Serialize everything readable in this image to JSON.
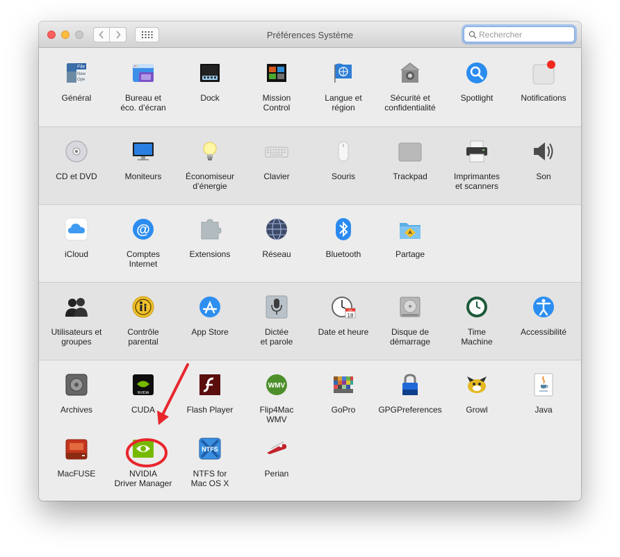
{
  "window": {
    "title": "Préférences Système"
  },
  "search": {
    "placeholder": "Rechercher"
  },
  "sections": [
    {
      "items": [
        {
          "label": "Général",
          "icon": "general-icon"
        },
        {
          "label": "Bureau et\néco. d’écran",
          "icon": "desktop-screensaver-icon"
        },
        {
          "label": "Dock",
          "icon": "dock-icon"
        },
        {
          "label": "Mission\nControl",
          "icon": "mission-control-icon"
        },
        {
          "label": "Langue et\nrégion",
          "icon": "language-region-icon"
        },
        {
          "label": "Sécurité et\nconfidentialité",
          "icon": "security-icon"
        },
        {
          "label": "Spotlight",
          "icon": "spotlight-icon"
        },
        {
          "label": "Notifications",
          "icon": "notifications-icon"
        }
      ]
    },
    {
      "items": [
        {
          "label": "CD et DVD",
          "icon": "cd-dvd-icon"
        },
        {
          "label": "Moniteurs",
          "icon": "displays-icon"
        },
        {
          "label": "Économiseur\nd’énergie",
          "icon": "energy-saver-icon"
        },
        {
          "label": "Clavier",
          "icon": "keyboard-icon"
        },
        {
          "label": "Souris",
          "icon": "mouse-icon"
        },
        {
          "label": "Trackpad",
          "icon": "trackpad-icon"
        },
        {
          "label": "Imprimantes\net scanners",
          "icon": "printer-icon"
        },
        {
          "label": "Son",
          "icon": "sound-icon"
        }
      ]
    },
    {
      "items": [
        {
          "label": "iCloud",
          "icon": "icloud-icon"
        },
        {
          "label": "Comptes\nInternet",
          "icon": "internet-accounts-icon"
        },
        {
          "label": "Extensions",
          "icon": "extensions-icon"
        },
        {
          "label": "Réseau",
          "icon": "network-icon"
        },
        {
          "label": "Bluetooth",
          "icon": "bluetooth-icon"
        },
        {
          "label": "Partage",
          "icon": "sharing-icon"
        }
      ]
    },
    {
      "items": [
        {
          "label": "Utilisateurs et\ngroupes",
          "icon": "users-groups-icon"
        },
        {
          "label": "Contrôle\nparental",
          "icon": "parental-controls-icon"
        },
        {
          "label": "App Store",
          "icon": "app-store-icon"
        },
        {
          "label": "Dictée\net parole",
          "icon": "dictation-icon"
        },
        {
          "label": "Date et heure",
          "icon": "date-time-icon"
        },
        {
          "label": "Disque de\ndémarrage",
          "icon": "startup-disk-icon"
        },
        {
          "label": "Time\nMachine",
          "icon": "time-machine-icon"
        },
        {
          "label": "Accessibilité",
          "icon": "accessibility-icon"
        }
      ]
    },
    {
      "items": [
        {
          "label": "Archives",
          "icon": "archives-icon"
        },
        {
          "label": "CUDA",
          "icon": "cuda-icon"
        },
        {
          "label": "Flash Player",
          "icon": "flash-player-icon"
        },
        {
          "label": "Flip4Mac\nWMV",
          "icon": "flip4mac-icon"
        },
        {
          "label": "GoPro",
          "icon": "gopro-icon"
        },
        {
          "label": "GPGPreferences",
          "icon": "gpg-icon"
        },
        {
          "label": "Growl",
          "icon": "growl-icon"
        },
        {
          "label": "Java",
          "icon": "java-icon"
        },
        {
          "label": "MacFUSE",
          "icon": "macfuse-icon"
        },
        {
          "label": "NVIDIA\nDriver Manager",
          "icon": "nvidia-driver-icon"
        },
        {
          "label": "NTFS for\nMac OS X",
          "icon": "ntfs-icon"
        },
        {
          "label": "Perian",
          "icon": "perian-icon"
        }
      ]
    }
  ],
  "icon_text": {
    "general": "File\nNew\nOpe",
    "cuda": "NVIDIA",
    "flip4mac": "WMV",
    "ntfs": "NTFS",
    "calendar_month": "JUL",
    "calendar_day": "18"
  },
  "annotation": {
    "color": "#e8262c"
  },
  "colors": {
    "accent": "#1e8bf0"
  }
}
